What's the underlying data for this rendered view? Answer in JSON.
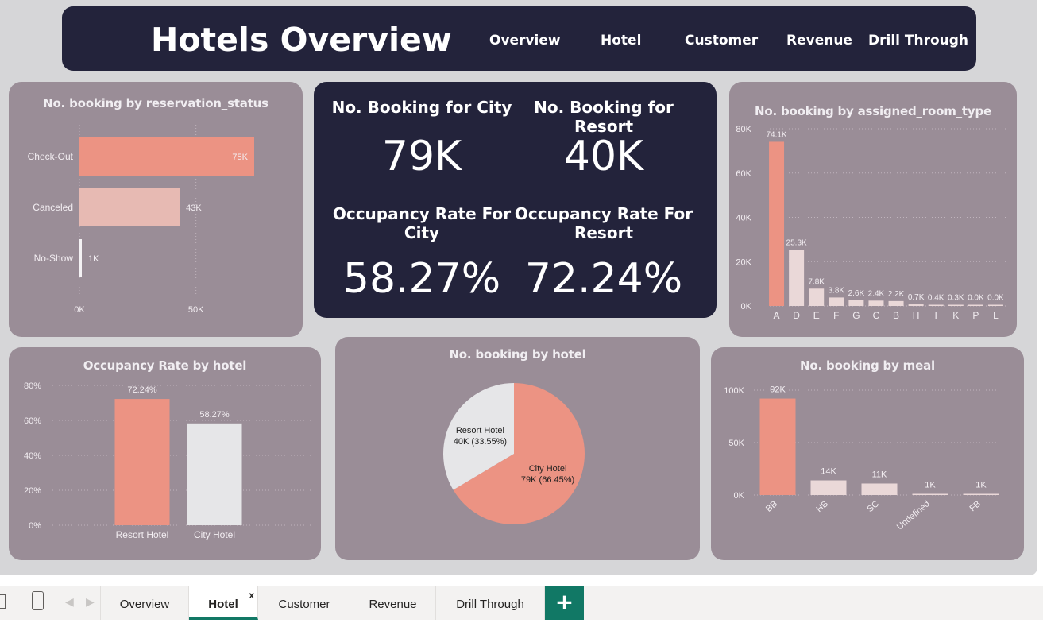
{
  "header": {
    "title": "Hotels Overview",
    "nav": [
      "Overview",
      "Hotel",
      "Customer",
      "Revenue",
      "Drill Through"
    ]
  },
  "kpis": {
    "city_bookings_label": "No. Booking for City",
    "city_bookings_value": "79K",
    "resort_bookings_label": "No. Booking for Resort",
    "resort_bookings_value": "40K",
    "city_occupancy_label": "Occupancy Rate For City",
    "city_occupancy_value": "58.27%",
    "resort_occupancy_label": "Occupancy Rate For Resort",
    "resort_occupancy_value": "72.24%"
  },
  "colors": {
    "accent": "#ec9383",
    "light_bar": "#e7bab3",
    "pale_bar": "#ead8d8",
    "white_bar": "#e6e6e8",
    "card_bg": "#9a8d97",
    "dark_bg": "#23233b",
    "tab_green": "#117865"
  },
  "chart_data": [
    {
      "id": "reservation_status",
      "type": "bar",
      "orientation": "horizontal",
      "title": "No. booking by reservation_status",
      "categories": [
        "Check-Out",
        "Canceled",
        "No-Show"
      ],
      "values": [
        75000,
        43000,
        1000
      ],
      "data_labels": [
        "75K",
        "43K",
        "1K"
      ],
      "xticks": [
        "0K",
        "50K"
      ],
      "xlim": [
        0,
        75000
      ],
      "grid": true
    },
    {
      "id": "assigned_room_type",
      "type": "bar",
      "title": "No. booking by assigned_room_type",
      "categories": [
        "A",
        "D",
        "E",
        "F",
        "G",
        "C",
        "B",
        "H",
        "I",
        "K",
        "P",
        "L"
      ],
      "values": [
        74100,
        25300,
        7800,
        3800,
        2600,
        2400,
        2200,
        700,
        400,
        300,
        0,
        0
      ],
      "data_labels": [
        "74.1K",
        "25.3K",
        "7.8K",
        "3.8K",
        "2.6K",
        "2.4K",
        "2.2K",
        "0.7K",
        "0.4K",
        "0.3K",
        "0.0K",
        "0.0K"
      ],
      "yticks": [
        "0K",
        "20K",
        "40K",
        "60K",
        "80K"
      ],
      "ylim": [
        0,
        80000
      ],
      "grid": true
    },
    {
      "id": "occupancy_by_hotel",
      "type": "bar",
      "title": "Occupancy Rate by hotel",
      "categories": [
        "Resort Hotel",
        "City Hotel"
      ],
      "values": [
        72.24,
        58.27
      ],
      "data_labels": [
        "72.24%",
        "58.27%"
      ],
      "yticks": [
        "0%",
        "20%",
        "40%",
        "60%",
        "80%"
      ],
      "ylim": [
        0,
        80
      ],
      "grid": true
    },
    {
      "id": "booking_by_hotel",
      "type": "pie",
      "title": "No. booking by hotel",
      "categories": [
        "City Hotel",
        "Resort Hotel"
      ],
      "values": [
        66.45,
        33.55
      ],
      "data_labels": [
        "79K (66.45%)",
        "40K (33.55%)"
      ]
    },
    {
      "id": "booking_by_meal",
      "type": "bar",
      "title": "No. booking by meal",
      "categories": [
        "BB",
        "HB",
        "SC",
        "Undefined",
        "FB"
      ],
      "values": [
        92000,
        14000,
        11000,
        1000,
        1000
      ],
      "data_labels": [
        "92K",
        "14K",
        "11K",
        "1K",
        "1K"
      ],
      "yticks": [
        "0K",
        "50K",
        "100K"
      ],
      "ylim": [
        0,
        100000
      ],
      "grid": true
    }
  ],
  "tabs": {
    "items": [
      "Overview",
      "Hotel",
      "Customer",
      "Revenue",
      "Drill Through"
    ],
    "active": "Hotel",
    "close_glyph": "x",
    "add_glyph": "+"
  }
}
